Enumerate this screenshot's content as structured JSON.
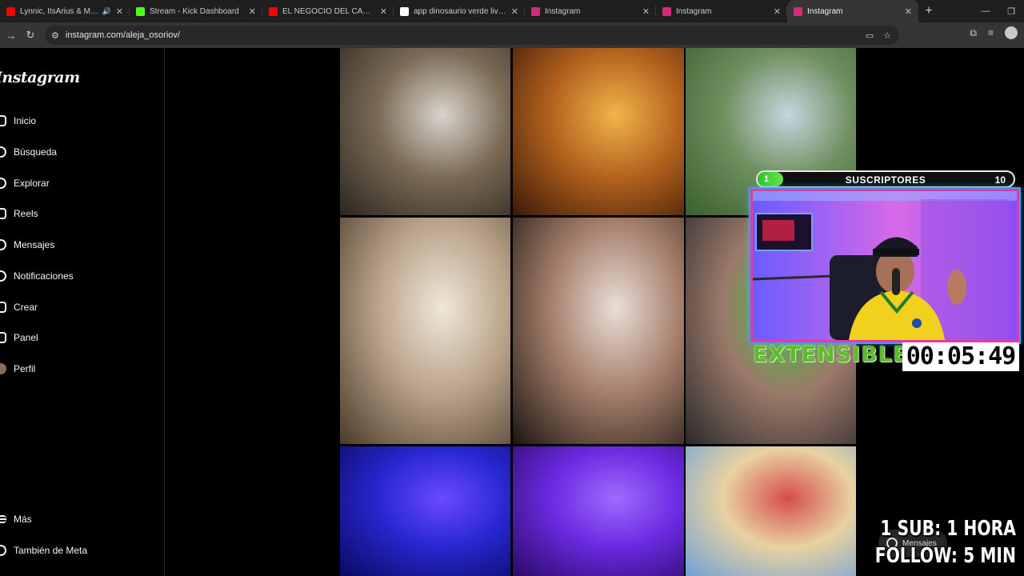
{
  "browser": {
    "tabs": [
      {
        "title": "Lynnic, ItsArius & Mocean -",
        "favicon_color": "#ff0000",
        "audio": true,
        "active": false
      },
      {
        "title": "Stream - Kick Dashboard",
        "favicon_color": "#53fc18",
        "active": false
      },
      {
        "title": "EL NEGOCIO DEL CARIÑO MAS",
        "favicon_color": "#ff0000",
        "active": false
      },
      {
        "title": "app dinosaurio verde live - Bus",
        "favicon_color": "#ffffff",
        "active": false
      },
      {
        "title": "Instagram",
        "favicon_color": "#d62976",
        "active": false
      },
      {
        "title": "Instagram",
        "favicon_color": "#d62976",
        "active": false
      },
      {
        "title": "Instagram",
        "favicon_color": "#d62976",
        "active": true
      }
    ],
    "new_tab_icon": "plus-icon",
    "url": "instagram.com/aleja_osoriov/"
  },
  "instagram": {
    "logo": "Instagram",
    "nav": [
      {
        "label": "Inicio",
        "icon": "home-icon"
      },
      {
        "label": "Búsqueda",
        "icon": "search-icon"
      },
      {
        "label": "Explorar",
        "icon": "compass-icon"
      },
      {
        "label": "Reels",
        "icon": "reels-icon"
      },
      {
        "label": "Mensajes",
        "icon": "messenger-icon"
      },
      {
        "label": "Notificaciones",
        "icon": "heart-icon"
      },
      {
        "label": "Crear",
        "icon": "plus-square-icon"
      },
      {
        "label": "Panel",
        "icon": "chart-icon"
      },
      {
        "label": "Perfil",
        "icon": "avatar-icon"
      }
    ],
    "bottom_nav": [
      {
        "label": "Más",
        "icon": "menu-icon"
      },
      {
        "label": "También de Meta",
        "icon": "meta-icon"
      }
    ],
    "posts": [
      {
        "desc": "woman-sparkler-street",
        "colors": [
          "#2b2620",
          "#7a6a55",
          "#d9d4cc"
        ]
      },
      {
        "desc": "glass-drink",
        "colors": [
          "#3b1a08",
          "#b3621d",
          "#f0b54a"
        ]
      },
      {
        "desc": "park-trees",
        "colors": [
          "#3b5f2e",
          "#6f8f5f",
          "#c6d6e0"
        ]
      },
      {
        "desc": "woman-doorway",
        "colors": [
          "#4a3a2a",
          "#b9a38a",
          "#efe7da"
        ]
      },
      {
        "desc": "woman-portrait",
        "colors": [
          "#1b1512",
          "#a47f6a",
          "#e8dfd8"
        ]
      },
      {
        "desc": "woman-green-top",
        "colors": [
          "#2a2a2a",
          "#9b7a6a",
          "#3ec43a"
        ]
      },
      {
        "desc": "blue-club-lights",
        "colors": [
          "#0a0a60",
          "#2727d0",
          "#6b4aff"
        ]
      },
      {
        "desc": "purple-light-selfie",
        "colors": [
          "#2a0a66",
          "#6a2ae0",
          "#a06bff"
        ]
      },
      {
        "desc": "umbrella-street",
        "colors": [
          "#6ea0d8",
          "#e8d2a0",
          "#d64c4c"
        ]
      }
    ],
    "messages_pill": "Mensajes"
  },
  "overlay": {
    "subs_current": "1",
    "subs_label": "SUSCRIPTORES",
    "subs_goal": "10",
    "subs_progress": 0.1,
    "extensible": "EXTENSIBLE",
    "timer": "00:05:49",
    "rule_1": "1 SUB: 1 HORA",
    "rule_2": "FOLLOW: 5 MIN"
  }
}
